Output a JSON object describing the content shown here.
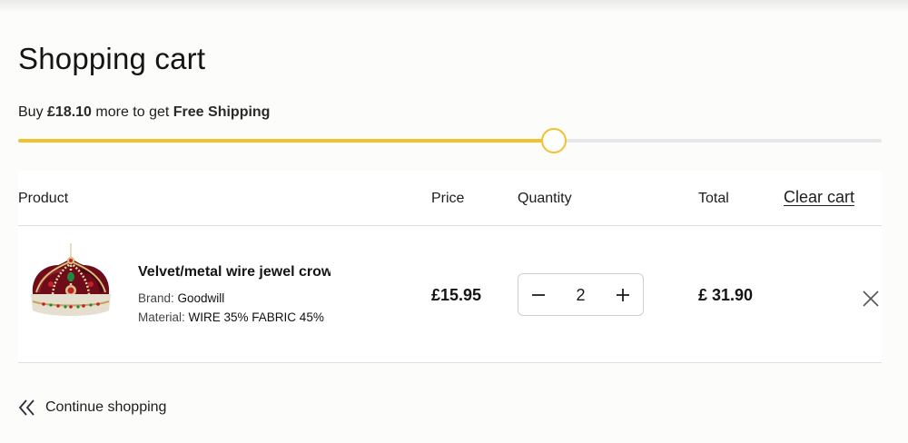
{
  "page": {
    "title": "Shopping cart"
  },
  "shipping": {
    "prefix": "Buy ",
    "amount": "£18.10",
    "middle": " more to get ",
    "goal": "Free Shipping",
    "progress_fraction": 0.62,
    "accent_color": "#f2c12e",
    "track_color": "#e6e7ea"
  },
  "table": {
    "headers": {
      "product": "Product",
      "price": "Price",
      "quantity": "Quantity",
      "total": "Total"
    },
    "clear_cart_label": "Clear cart"
  },
  "items": [
    {
      "name": "Velvet/metal wire jewel crown",
      "brand_label": "Brand: ",
      "brand": "Goodwill",
      "material_label": "Material: ",
      "material": "WIRE 35% FABRIC 45%",
      "image_icon": "crown-product-image",
      "price": "£15.95",
      "quantity": "2",
      "total": "£ 31.90"
    }
  ],
  "footer": {
    "continue_label": "Continue shopping",
    "continue_icon": "double-chevron-left-icon"
  }
}
